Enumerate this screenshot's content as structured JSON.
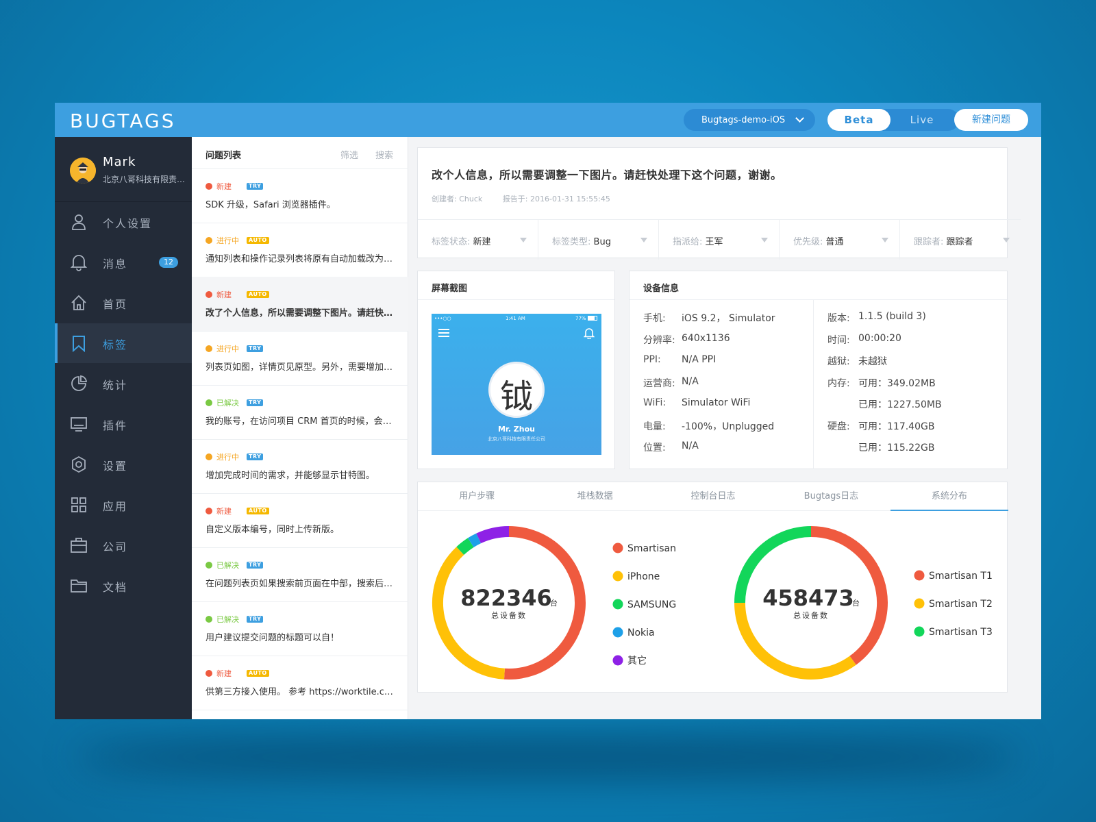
{
  "app": {
    "logo": "BUGTAGS"
  },
  "header": {
    "project": "Bugtags-demo-iOS",
    "env_options": [
      "Beta",
      "Live"
    ],
    "env_active": "Beta",
    "new_issue": "新建问题"
  },
  "user": {
    "name": "Mark",
    "org": "北京八哥科技有限责任公司"
  },
  "nav": [
    {
      "label": "个人设置",
      "icon": "user-icon"
    },
    {
      "label": "消息",
      "icon": "bell-icon",
      "badge": "12"
    },
    {
      "label": "首页",
      "icon": "home-icon"
    },
    {
      "label": "标签",
      "icon": "bookmark-icon",
      "active": true
    },
    {
      "label": "统计",
      "icon": "pie-chart-icon"
    },
    {
      "label": "插件",
      "icon": "monitor-icon"
    },
    {
      "label": "设置",
      "icon": "settings-icon"
    },
    {
      "label": "应用",
      "icon": "apps-grid-icon"
    },
    {
      "label": "公司",
      "icon": "briefcase-icon"
    },
    {
      "label": "文档",
      "icon": "folder-icon"
    }
  ],
  "issues_panel": {
    "title": "问题列表",
    "filter": "筛选",
    "search": "搜索",
    "items": [
      {
        "status": "新建",
        "tag": "TRY",
        "text": "SDK 升级，Safari 浏览器插件。"
      },
      {
        "status": "进行中",
        "tag": "AUTO",
        "text": "通知列表和操作记录列表将原有自动加载改为手动加载"
      },
      {
        "status": "新建",
        "tag": "AUTO",
        "text": "改了个人信息，所以需要调整下图片。请赶快处理下",
        "selected": true
      },
      {
        "status": "进行中",
        "tag": "TRY",
        "text": "列表页如图，详情页见原型。另外，需要增加一个筛选"
      },
      {
        "status": "已解决",
        "tag": "TRY",
        "text": "我的账号，在访问项目 CRM 首页的时候，会出现问题"
      },
      {
        "status": "进行中",
        "tag": "TRY",
        "text": "增加完成时间的需求，并能够显示甘特图。"
      },
      {
        "status": "新建",
        "tag": "AUTO",
        "text": "自定义版本编号，同时上传新版。"
      },
      {
        "status": "已解决",
        "tag": "TRY",
        "text": "在问题列表页如果搜索前页面在中部，搜索后位置不变"
      },
      {
        "status": "已解决",
        "tag": "TRY",
        "text": "用户建议提交问题的标题可以自！"
      },
      {
        "status": "新建",
        "tag": "AUTO",
        "text": "供第三方接入使用。 参考 https://worktile.com"
      }
    ]
  },
  "status_colors": {
    "新建": "#ef5a3f",
    "进行中": "#f5a623",
    "已解决": "#7ac943"
  },
  "tag_colors": {
    "TRY": "#3d9fe0",
    "AUTO": "#f5b800"
  },
  "issue": {
    "title": "改个人信息，所以需要调整一下图片。请赶快处理下这个问题，谢谢。",
    "creator_label": "创建者:",
    "creator": "Chuck",
    "reported_label": "报告于:",
    "reported_at": "2016-01-31 15:55:45",
    "props": [
      {
        "key": "标签状态:",
        "value": "新建"
      },
      {
        "key": "标签类型:",
        "value": "Bug"
      },
      {
        "key": "指派给:",
        "value": "王军"
      },
      {
        "key": "优先级:",
        "value": "普通"
      },
      {
        "key": "跟踪者:",
        "value": "跟踪者"
      }
    ]
  },
  "screenshot": {
    "title": "屏幕截图",
    "status_time": "1:41 AM",
    "status_battery": "77%",
    "signal": "•••○○",
    "profile_name": "Mr. Zhou",
    "profile_org": "北京八哥科技有限责任公司",
    "profile_glyph": "钺"
  },
  "device": {
    "title": "设备信息",
    "left": [
      {
        "k": "手机:",
        "v": "iOS 9.2， Simulator"
      },
      {
        "k": "分辨率:",
        "v": "640x1136"
      },
      {
        "k": "PPI:",
        "v": "N/A PPI"
      },
      {
        "k": "运营商:",
        "v": "N/A"
      },
      {
        "k": "WiFi:",
        "v": "Simulator WiFi"
      },
      {
        "k": "电量:",
        "v": "-100%，Unplugged"
      },
      {
        "k": "位置:",
        "v": "N/A"
      }
    ],
    "right": [
      {
        "k": "版本:",
        "v": "1.1.5 (build 3)"
      },
      {
        "k": "时间:",
        "v": "00:00:20"
      },
      {
        "k": "越狱:",
        "v": "未越狱"
      },
      {
        "k": "内存:",
        "v": "可用：349.02MB"
      },
      {
        "k": "",
        "v": "已用：1227.50MB"
      },
      {
        "k": "硬盘:",
        "v": "可用：117.40GB"
      },
      {
        "k": "",
        "v": "已用：115.22GB"
      }
    ]
  },
  "tabs": [
    "用户步骤",
    "堆栈数据",
    "控制台日志",
    "Bugtags日志",
    "系统分布"
  ],
  "active_tab": "系统分布",
  "chart_data": [
    {
      "type": "pie",
      "total": "822346",
      "unit": "台",
      "caption": "总设备数",
      "categories": [
        "Smartisan",
        "iPhone",
        "SAMSUNG",
        "Nokia",
        "其它"
      ],
      "values": [
        51,
        37,
        3,
        2,
        7
      ],
      "colors": [
        "#ef5a3f",
        "#ffc107",
        "#12d65a",
        "#1ea0e8",
        "#8e21e6"
      ]
    },
    {
      "type": "pie",
      "total": "458473",
      "unit": "台",
      "caption": "总设备数",
      "categories": [
        "Smartisan T1",
        "Smartisan T2",
        "Smartisan T3"
      ],
      "values": [
        40,
        35,
        25
      ],
      "colors": [
        "#ef5a3f",
        "#ffc107",
        "#12d65a"
      ]
    }
  ]
}
